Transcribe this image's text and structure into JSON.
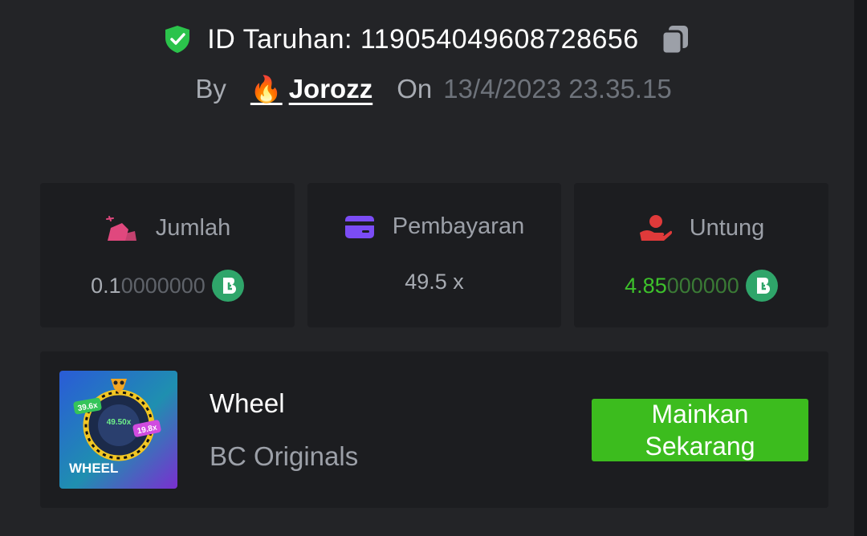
{
  "header": {
    "bet_id_label": "ID Taruhan: 1190540496087286​56",
    "by_label": "By",
    "user": {
      "emoji": "🔥",
      "name": "Jorozz"
    },
    "on_label": "On",
    "date": "13/4/2023 23.35.15"
  },
  "stats": [
    {
      "label": "Jumlah",
      "icon": "money-bag-icon",
      "value_main": "0.1",
      "value_rest": "0000000",
      "coin": "bc-coin-icon"
    },
    {
      "label": "Pembayaran",
      "icon": "card-icon",
      "value": "49.5 x"
    },
    {
      "label": "Untung",
      "icon": "profit-hand-icon",
      "value_main": "4.85",
      "value_rest": "000000",
      "coin": "bc-coin-icon"
    }
  ],
  "game": {
    "title": "Wheel",
    "provider": "BC Originals",
    "thumb": {
      "label": "WHEEL",
      "m1": "39.6x",
      "m2": "49.50x",
      "m3": "19.8x"
    },
    "play_line1": "Mainkan",
    "play_line2": "Sekarang"
  },
  "colors": {
    "background": "#232427",
    "card": "#1c1d20",
    "accent_green": "#3cbc1e",
    "profit_green": "#3dc12b",
    "shield_green": "#2bc34b",
    "coin_green": "#2fa56a",
    "jumlah_icon": "#e0487e",
    "pembayaran_icon": "#7b4cf5",
    "untung_icon": "#e03a3a"
  }
}
